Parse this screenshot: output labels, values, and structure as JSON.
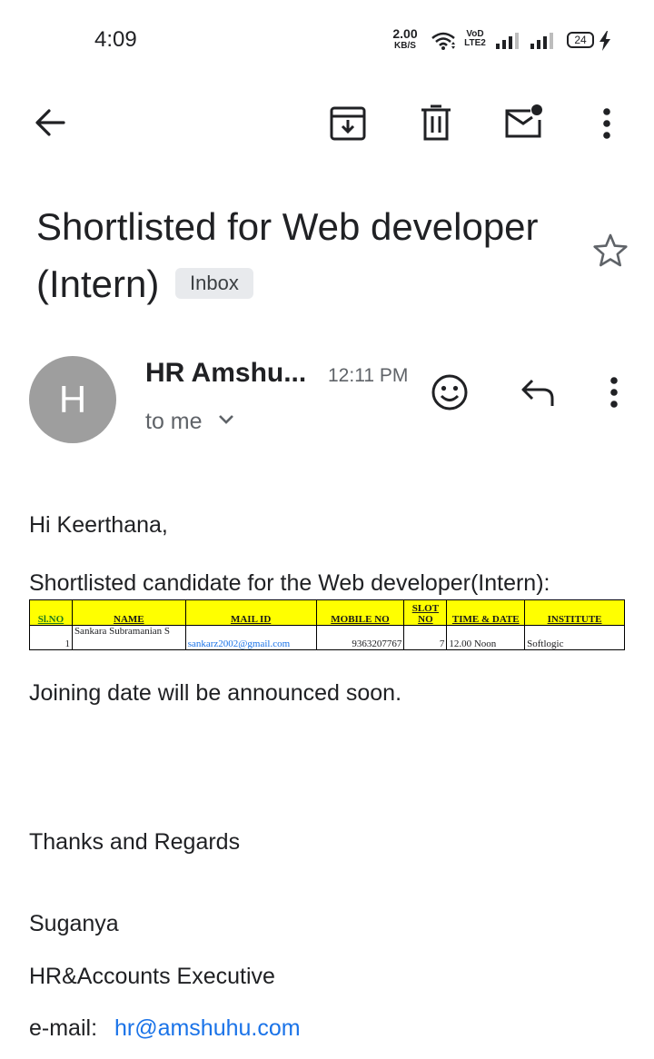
{
  "status_bar": {
    "time": "4:09",
    "speed_value": "2.00",
    "speed_unit": "KB/S",
    "volte_top": "VoD",
    "volte_bottom": "LTE2",
    "battery": "24"
  },
  "toolbar": {
    "back_icon": "arrow-back-icon",
    "archive_icon": "archive-icon",
    "delete_icon": "trash-icon",
    "mark_unread_icon": "mail-unread-icon",
    "more_icon": "more-vert-icon"
  },
  "email": {
    "subject": "Shortlisted for Web developer (Intern)",
    "label": "Inbox",
    "sender": "HR Amshu...",
    "avatar_letter": "H",
    "time": "12:11 PM",
    "recipient": "to me",
    "greeting": "Hi Keerthana,",
    "intro": "Shortlisted candidate for the Web developer(Intern):",
    "table": {
      "headers": [
        "Sl.NO",
        "NAME",
        "MAIL ID",
        "MOBILE NO",
        "SLOT NO",
        "TIME & DATE",
        "INSTITUTE"
      ],
      "rows": [
        [
          "1",
          "Sankara Subramanian S",
          "sankarz2002@gmail.com",
          "9363207767",
          "7",
          "12.00 Noon",
          "Softlogic"
        ]
      ]
    },
    "joining": "Joining date will be announced soon.",
    "closing": "Thanks and Regards",
    "signature_name": "Suganya",
    "signature_title": "HR&Accounts Executive",
    "signature_email_label": "e-mail:",
    "signature_email": "hr@amshuhu.com"
  },
  "colors": {
    "table_header_bg": "#ffff00",
    "link": "#1a73e8",
    "avatar_bg": "#9e9e9e"
  }
}
